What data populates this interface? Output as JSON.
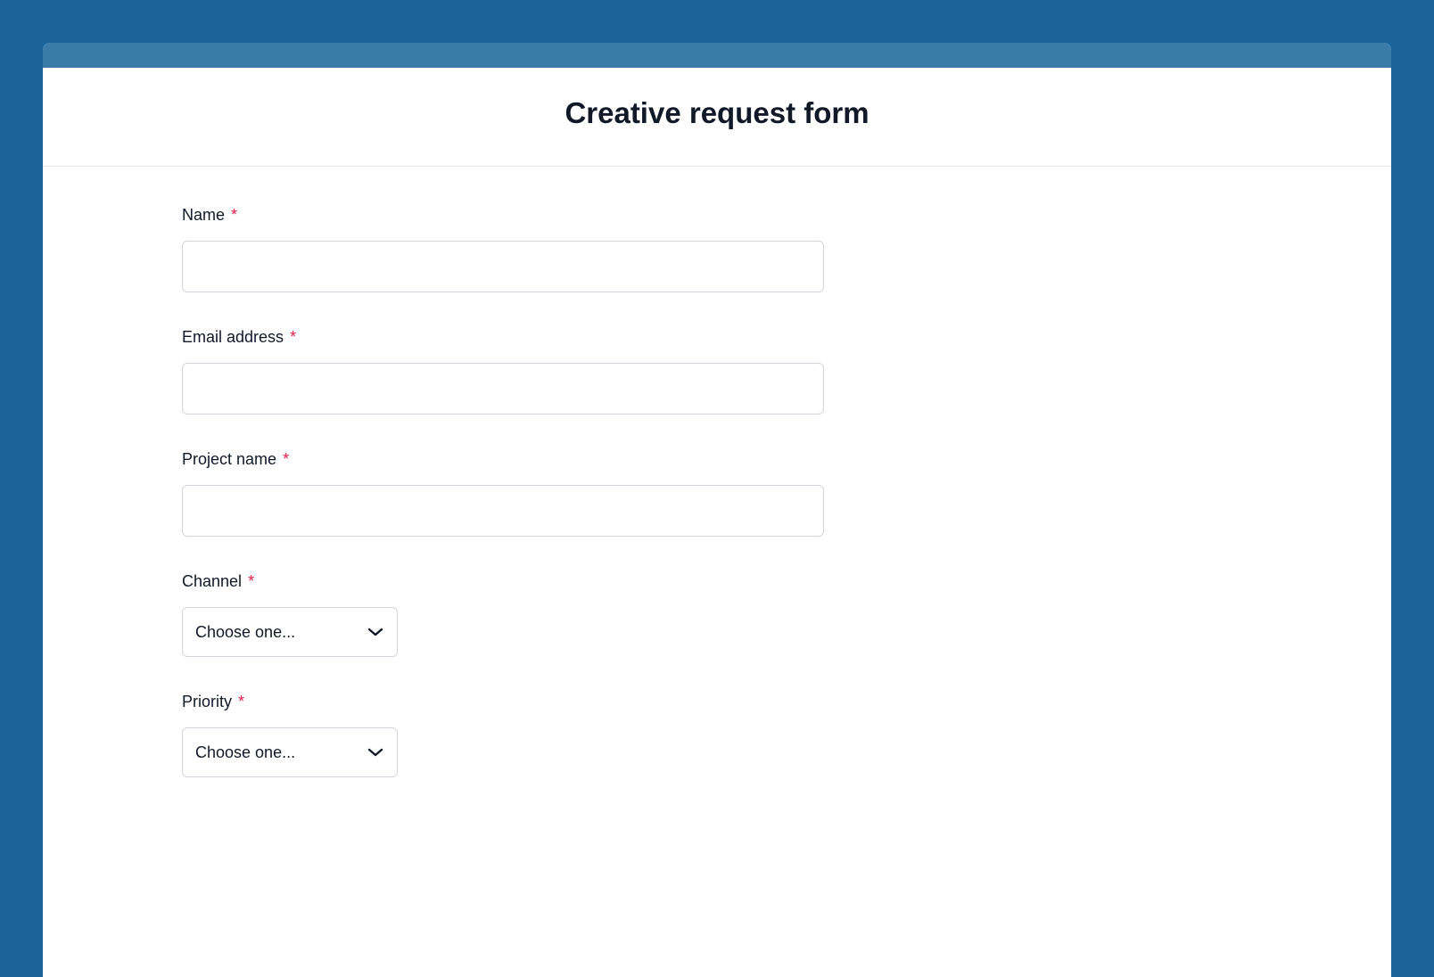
{
  "form": {
    "title": "Creative request form",
    "required_marker": "*",
    "fields": {
      "name": {
        "label": "Name",
        "required": true,
        "value": ""
      },
      "email": {
        "label": "Email address",
        "required": true,
        "value": ""
      },
      "project_name": {
        "label": "Project name",
        "required": true,
        "value": ""
      },
      "channel": {
        "label": "Channel",
        "required": true,
        "selected": "Choose one..."
      },
      "priority": {
        "label": "Priority",
        "required": true,
        "selected": "Choose one..."
      }
    }
  },
  "colors": {
    "page_bg": "#1b6399",
    "accent_bar": "#3a7ba7",
    "text": "#111827",
    "border": "#d1d5db",
    "required": "#e11d48"
  }
}
